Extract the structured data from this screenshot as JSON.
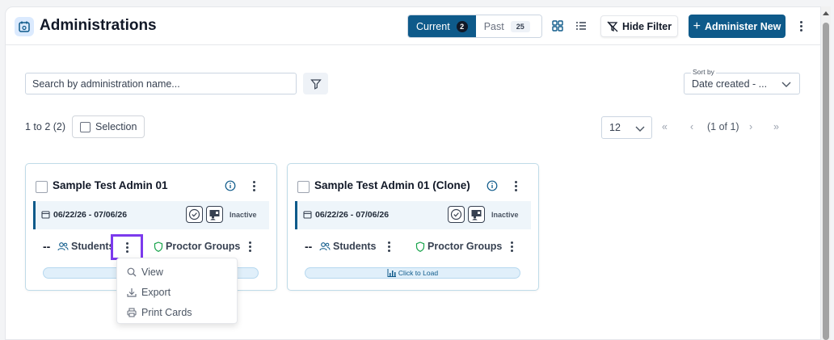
{
  "header": {
    "title": "Administrations",
    "tabs": [
      {
        "label": "Current",
        "count": "2"
      },
      {
        "label": "Past",
        "count": "25"
      }
    ],
    "hide_filter_label": "Hide Filter",
    "administer_label": "Administer New"
  },
  "filters": {
    "search_placeholder": "Search by administration name...",
    "sort_label": "Sort by",
    "sort_value": "Date created - ..."
  },
  "list_controls": {
    "range": "1 to 2 (2)",
    "selection_label": "Selection",
    "per_page": "12",
    "page_info": "(1 of 1)",
    "first_page": "«",
    "prev_page": "‹",
    "next_page": "›",
    "last_page": "»"
  },
  "cards": [
    {
      "title": "Sample Test Admin 01",
      "dates": "06/22/26 - 07/06/26",
      "status": "Inactive",
      "count": "--",
      "students_label": "Students",
      "groups_label": "Proctor Groups",
      "load_label": ""
    },
    {
      "title": "Sample Test Admin 01 (Clone)",
      "dates": "06/22/26 - 07/06/26",
      "status": "Inactive",
      "count": "--",
      "students_label": "Students",
      "groups_label": "Proctor Groups",
      "load_label": "Click to Load"
    }
  ],
  "context_menu": {
    "items": [
      "View",
      "Export",
      "Print Cards"
    ]
  },
  "colors": {
    "primary": "#0e5a8a",
    "highlight": "#7c3aed",
    "card_border": "#bfdbe8"
  }
}
